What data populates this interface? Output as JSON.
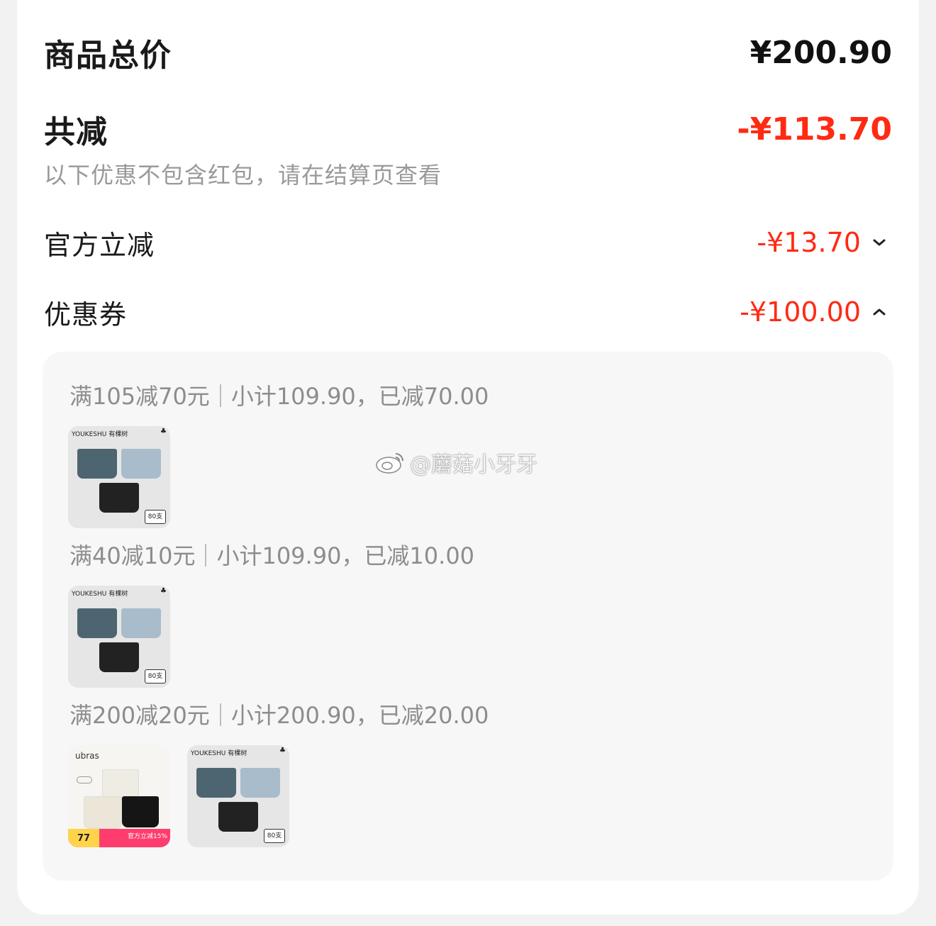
{
  "summary": {
    "total_label": "商品总价",
    "total_value": "¥200.90",
    "saved_label": "共减",
    "saved_value": "-¥113.70",
    "note": "以下优惠不包含红包，请在结算页查看"
  },
  "discounts": {
    "official_label": "官方立减",
    "official_value": "-¥13.70",
    "coupon_label": "优惠券",
    "coupon_value": "-¥100.00"
  },
  "coupons": [
    {
      "rule": "满105减70元",
      "detail": "小计109.90，已减70.00"
    },
    {
      "rule": "满40减10元",
      "detail": "小计109.90，已减10.00"
    },
    {
      "rule": "满200减20元",
      "detail": "小计200.90，已减20.00"
    }
  ],
  "products": {
    "youkeshu_brand": "YOUKESHU 有棵树",
    "youkeshu_badge": "80支",
    "ubras_brand": "ubras",
    "ubras_price": "77",
    "ubras_promo": "官方立减15%"
  },
  "watermark": "@蘑菇小牙牙",
  "colors": {
    "accent_red": "#ff2a13",
    "panel": "#f7f7f7",
    "muted": "#999999"
  }
}
